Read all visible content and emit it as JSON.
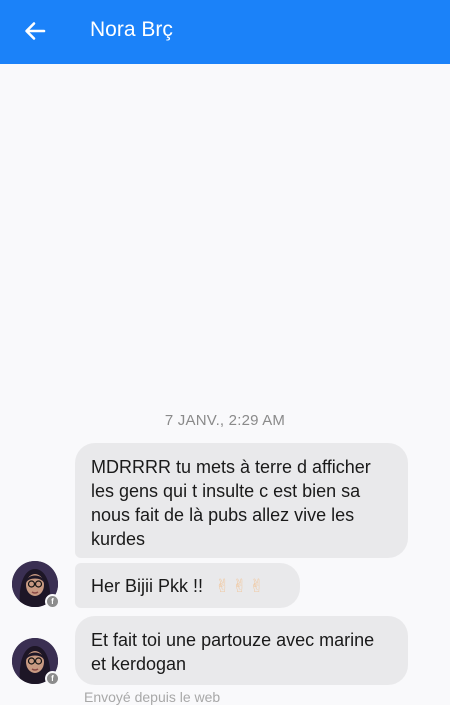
{
  "header": {
    "title": "Nora Brç",
    "back_icon": "arrow-left-icon",
    "background": "#1b82f9"
  },
  "conversation": {
    "timestamp": "7 JANV., 2:29 AM",
    "messages": [
      {
        "text": "MDRRRR tu mets à terre d afficher les gens qui t insulte c est bien sa nous fait de là pubs allez vive les kurdes"
      },
      {
        "text": "Her Bijii Pkk !!",
        "emoji": "✌✌✌"
      },
      {
        "text": "Et fait toi une partouze avec marine  et kerdogan"
      }
    ],
    "sent_from": "Envoyé depuis le web"
  }
}
